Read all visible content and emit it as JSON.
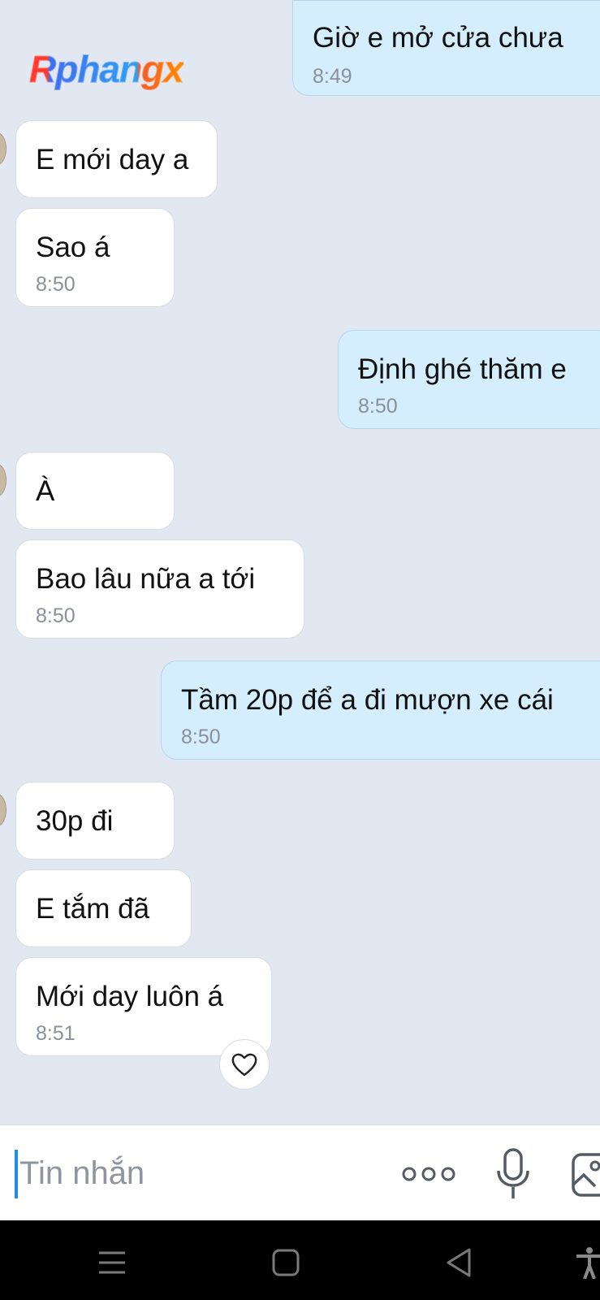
{
  "watermark": {
    "text": "Rphangx"
  },
  "messages": [
    {
      "side": "out",
      "text": "Giờ e mở cửa chưa",
      "time": "8:49"
    },
    {
      "side": "in",
      "text": "E mới day a",
      "time": ""
    },
    {
      "side": "in",
      "text": "Sao á",
      "time": "8:50"
    },
    {
      "side": "out",
      "text": "Định ghé thăm e",
      "time": "8:50"
    },
    {
      "side": "in",
      "text": "À",
      "time": ""
    },
    {
      "side": "in",
      "text": "Bao lâu nữa a tới",
      "time": "8:50"
    },
    {
      "side": "out",
      "text": "Tầm 20p để a đi mượn xe cái",
      "time": "8:50"
    },
    {
      "side": "in",
      "text": "30p đi",
      "time": ""
    },
    {
      "side": "in",
      "text": "E tắm đã",
      "time": ""
    },
    {
      "side": "in",
      "text": "Mới day luôn á",
      "time": "8:51"
    }
  ],
  "input": {
    "placeholder": "Tin nhắn"
  },
  "icons": {
    "reaction": "heart-icon",
    "more": "more-dots-icon",
    "mic": "microphone-icon",
    "image": "image-icon",
    "nav": [
      "menu-icon",
      "home-icon",
      "back-icon",
      "accessibility-icon"
    ]
  },
  "colors": {
    "background": "#e2e8f1",
    "incoming_bubble": "#ffffff",
    "outgoing_bubble": "#d5eefe",
    "caret": "#1f8ef1",
    "navbar": "#000000"
  }
}
